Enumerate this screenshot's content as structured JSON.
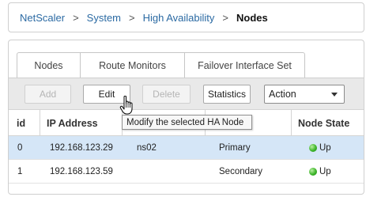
{
  "breadcrumb": {
    "items": [
      "NetScaler",
      "System",
      "High Availability"
    ],
    "current": "Nodes",
    "separator": ">"
  },
  "tabs": [
    {
      "label": "Nodes",
      "active": true
    },
    {
      "label": "Route Monitors",
      "active": false
    },
    {
      "label": "Failover Interface Set",
      "active": false
    }
  ],
  "toolbar": {
    "add_label": "Add",
    "edit_label": "Edit",
    "delete_label": "Delete",
    "statistics_label": "Statistics",
    "action_label": "Action"
  },
  "tooltip": "Modify the selected HA Node",
  "table": {
    "headers": {
      "id": "id",
      "ip": "IP Address",
      "name": "",
      "state": "State",
      "node_state": "Node State"
    },
    "rows": [
      {
        "id": "0",
        "ip": "192.168.123.29",
        "name": "ns02",
        "state": "Primary",
        "node_state": "Up",
        "selected": true
      },
      {
        "id": "1",
        "ip": "192.168.123.59",
        "name": "",
        "state": "Secondary",
        "node_state": "Up",
        "selected": false
      }
    ]
  },
  "colors": {
    "link": "#2b6aa3",
    "selected_row": "#d5e6f7",
    "status_up": "#3db52a"
  }
}
